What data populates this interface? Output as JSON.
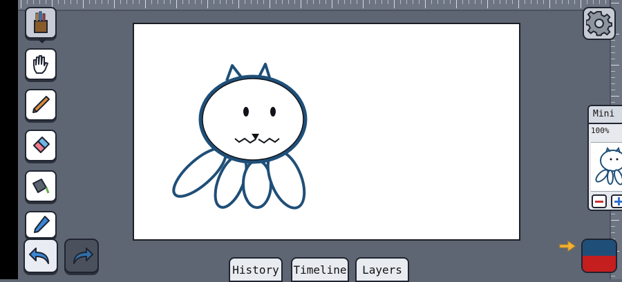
{
  "app": {
    "accent_color": "#1f4f78",
    "background_color": "#5f6673"
  },
  "toolbar": {
    "tools": [
      {
        "name": "brush-set",
        "icon": "paint-brushes-cup-icon",
        "active": true
      },
      {
        "name": "hand",
        "icon": "hand-glove-icon"
      },
      {
        "name": "pencil",
        "icon": "pencil-icon"
      },
      {
        "name": "eraser",
        "icon": "eraser-icon"
      },
      {
        "name": "fill",
        "icon": "paint-bucket-icon"
      },
      {
        "name": "eyedropper",
        "icon": "eyedropper-icon"
      }
    ],
    "undo_icon": "undo-arrow-icon",
    "redo_icon": "redo-arrow-icon"
  },
  "settings": {
    "icon": "gear-icon"
  },
  "mini_panel": {
    "title": "Mini",
    "zoom": "100%",
    "zoom_out_icon": "minus-icon",
    "zoom_in_icon": "plus-icon"
  },
  "colors": {
    "primary": "#1f4f78",
    "secondary": "#c41e1e",
    "arrow_icon": "right-arrow-icon"
  },
  "tabs": [
    {
      "label": "History"
    },
    {
      "label": "Timeline"
    },
    {
      "label": "Layers"
    }
  ]
}
